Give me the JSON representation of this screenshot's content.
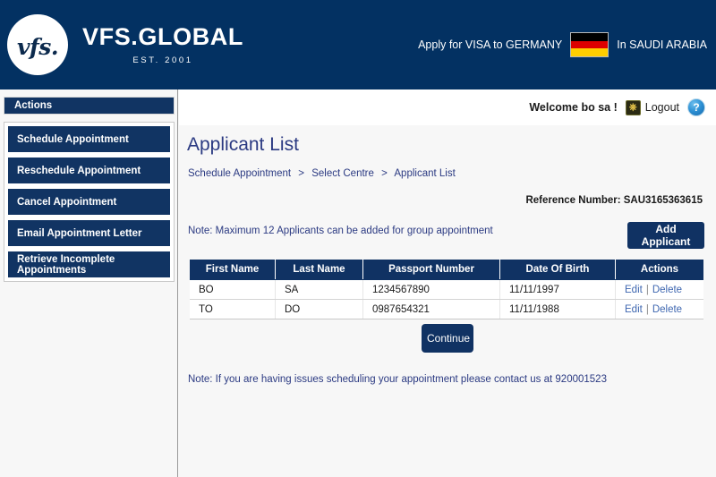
{
  "header": {
    "logo_mark": "vfs.",
    "brand_name": "VFS.GLOBAL",
    "brand_est": "EST. 2001",
    "apply_prefix": "Apply for VISA to GERMANY",
    "apply_suffix": "In SAUDI ARABIA",
    "flag_icon": "germany-flag-icon",
    "brand_color": "#033162"
  },
  "topbar": {
    "welcome": "Welcome bo sa !",
    "logout": "Logout",
    "logout_icon": "power-icon",
    "help_icon": "question-mark-icon",
    "help_glyph": "?"
  },
  "sidebar": {
    "heading": "Actions",
    "items": [
      {
        "label": "Schedule Appointment"
      },
      {
        "label": "Reschedule Appointment"
      },
      {
        "label": "Cancel Appointment"
      },
      {
        "label": "Email Appointment Letter"
      },
      {
        "label": "Retrieve Incomplete Appointments"
      }
    ]
  },
  "main": {
    "title": "Applicant List",
    "breadcrumb": [
      {
        "label": "Schedule Appointment"
      },
      {
        "label": "Select Centre"
      },
      {
        "label": "Applicant List"
      }
    ],
    "breadcrumb_separator": ">",
    "reference_label": "Reference Number:",
    "reference_value": "SAU3165363615",
    "reference_full": "Reference Number: SAU3165363615",
    "note_top": "Note: Maximum 12 Applicants can be added for group appointment",
    "add_applicant_label": "Add Applicant",
    "continue_label": "Continue",
    "note_bottom": "Note: If you are having issues scheduling your appointment please contact us at 920001523"
  },
  "table": {
    "columns": [
      "First Name",
      "Last Name",
      "Passport Number",
      "Date Of Birth",
      "Actions"
    ],
    "rows": [
      {
        "first_name": "BO",
        "last_name": "SA",
        "passport": "1234567890",
        "dob": "11/11/1997",
        "edit": "Edit",
        "separator": "|",
        "delete": "Delete"
      },
      {
        "first_name": "TO",
        "last_name": "DO",
        "passport": "0987654321",
        "dob": "11/11/1988",
        "edit": "Edit",
        "separator": "|",
        "delete": "Delete"
      }
    ]
  }
}
